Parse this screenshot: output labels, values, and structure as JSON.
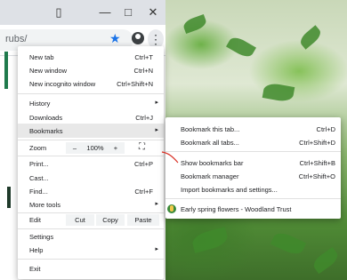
{
  "browser": {
    "url_text": "rubs/",
    "window_controls": [
      "▯",
      "—",
      "□",
      "✕"
    ],
    "star_icon": "★",
    "kebab_icon": "⋮"
  },
  "menu": {
    "new_tab": {
      "label": "New tab",
      "shortcut": "Ctrl+T"
    },
    "new_window": {
      "label": "New window",
      "shortcut": "Ctrl+N"
    },
    "incognito": {
      "label": "New incognito window",
      "shortcut": "Ctrl+Shift+N"
    },
    "history": {
      "label": "History"
    },
    "downloads": {
      "label": "Downloads",
      "shortcut": "Ctrl+J"
    },
    "bookmarks": {
      "label": "Bookmarks"
    },
    "zoom": {
      "label": "Zoom",
      "minus": "–",
      "value": "100%",
      "plus": "+",
      "fullscreen": "⛶"
    },
    "print": {
      "label": "Print...",
      "shortcut": "Ctrl+P"
    },
    "cast": {
      "label": "Cast..."
    },
    "find": {
      "label": "Find...",
      "shortcut": "Ctrl+F"
    },
    "more_tools": {
      "label": "More tools"
    },
    "edit": {
      "label": "Edit",
      "cut": "Cut",
      "copy": "Copy",
      "paste": "Paste"
    },
    "settings": {
      "label": "Settings"
    },
    "help": {
      "label": "Help"
    },
    "exit": {
      "label": "Exit"
    },
    "arrow": "▸"
  },
  "bookmarks_submenu": {
    "bookmark_tab": {
      "label": "Bookmark this tab...",
      "shortcut": "Ctrl+D"
    },
    "bookmark_all": {
      "label": "Bookmark all tabs...",
      "shortcut": "Ctrl+Shift+D"
    },
    "show_bar": {
      "label": "Show bookmarks bar",
      "shortcut": "Ctrl+Shift+B"
    },
    "manager": {
      "label": "Bookmark manager",
      "shortcut": "Ctrl+Shift+O"
    },
    "import": {
      "label": "Import bookmarks and settings..."
    },
    "saved": {
      "label": "Early spring flowers - Woodland Trust"
    }
  },
  "colors": {
    "accent": "#1a73e8",
    "highlight": "#e8e8e8",
    "annotation": "#d93025"
  }
}
